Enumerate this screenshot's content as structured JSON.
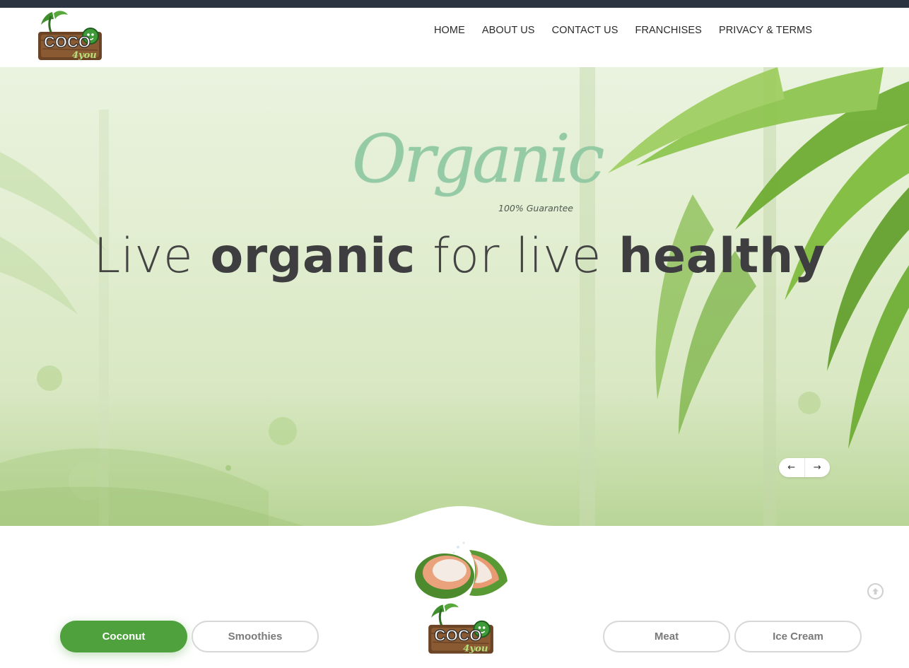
{
  "nav": {
    "items": [
      {
        "label": "HOME"
      },
      {
        "label": "ABOUT US"
      },
      {
        "label": "CONTACT US"
      },
      {
        "label": "FRANCHISES"
      },
      {
        "label": "PRIVACY & TERMS"
      }
    ]
  },
  "logo": {
    "brand_text": "COCO",
    "sub_text": "4you"
  },
  "hero": {
    "script_word": "Organic",
    "guarantee": "100% Guarantee",
    "headline": {
      "w1": "Live",
      "w2": "organic",
      "w3": "for live",
      "w4": "healthy"
    },
    "prev_arrow": "←",
    "next_arrow": "→"
  },
  "categories": [
    {
      "label": "Coconut",
      "active": true
    },
    {
      "label": "Smoothies",
      "active": false
    },
    {
      "label": "Meat",
      "active": false
    },
    {
      "label": "Ice Cream",
      "active": false
    }
  ],
  "colors": {
    "accent": "#4fa13e",
    "topbar": "#2b3440",
    "text_dark": "#3e3e40"
  },
  "icons": {
    "scroll_top": "arrow-up-circle-icon"
  }
}
